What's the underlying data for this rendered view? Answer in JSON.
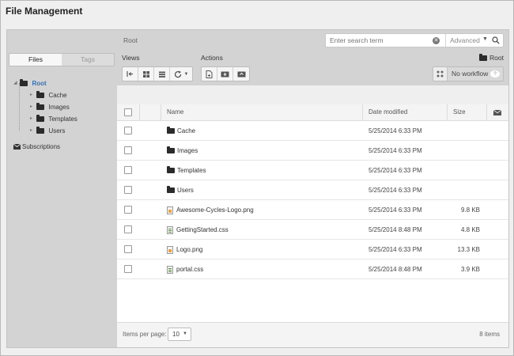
{
  "page": {
    "title": "File Management"
  },
  "sidebar": {
    "tabs": [
      {
        "label": "Files",
        "active": true
      },
      {
        "label": "Tags",
        "active": false
      }
    ],
    "tree": {
      "root": "Root",
      "children": [
        "Cache",
        "Images",
        "Templates",
        "Users"
      ]
    },
    "subscriptions": "Subscriptions"
  },
  "toolbar": {
    "breadcrumb": "Root",
    "search": {
      "placeholder": "Enter search term",
      "value": "",
      "advanced": "Advanced"
    },
    "views_label": "Views",
    "actions_label": "Actions",
    "current_folder": "Root",
    "workflow": "No workflow"
  },
  "table": {
    "headers": {
      "name": "Name",
      "date": "Date modified",
      "size": "Size"
    },
    "rows": [
      {
        "type": "folder",
        "name": "Cache",
        "date": "5/25/2014 6:33 PM",
        "size": ""
      },
      {
        "type": "folder",
        "name": "Images",
        "date": "5/25/2014 6:33 PM",
        "size": ""
      },
      {
        "type": "folder",
        "name": "Templates",
        "date": "5/25/2014 6:33 PM",
        "size": ""
      },
      {
        "type": "folder",
        "name": "Users",
        "date": "5/25/2014 6:33 PM",
        "size": ""
      },
      {
        "type": "png",
        "name": "Awesome-Cycles-Logo.png",
        "date": "5/25/2014 6:33 PM",
        "size": "9.8 KB"
      },
      {
        "type": "css",
        "name": "GettingStarted.css",
        "date": "5/25/2014 8:48 PM",
        "size": "4.8 KB"
      },
      {
        "type": "png",
        "name": "Logo.png",
        "date": "5/25/2014 6:33 PM",
        "size": "13.3 KB"
      },
      {
        "type": "css",
        "name": "portal.css",
        "date": "5/25/2014 8:48 PM",
        "size": "3.9 KB"
      }
    ]
  },
  "footer": {
    "items_per_page_label": "Items per page:",
    "items_per_page": "10",
    "count": "8 items"
  }
}
